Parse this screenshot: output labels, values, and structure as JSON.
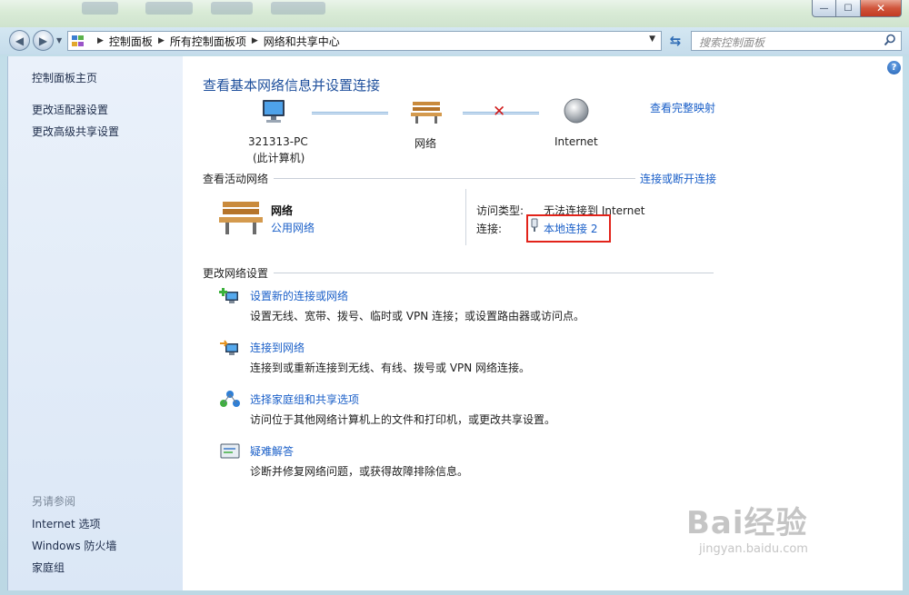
{
  "window": {
    "controls": {
      "minimize": "—",
      "maximize": "☐",
      "close": "✕"
    }
  },
  "address": {
    "breadcrumbs": [
      "控制面板",
      "所有控制面板项",
      "网络和共享中心"
    ],
    "search_placeholder": "搜索控制面板"
  },
  "sidebar": {
    "links": [
      "控制面板主页",
      "更改适配器设置",
      "更改高级共享设置"
    ],
    "see_also_heading": "另请参阅",
    "see_also": [
      "Internet 选项",
      "Windows 防火墙",
      "家庭组"
    ]
  },
  "main": {
    "help_icon": "?",
    "heading": "查看基本网络信息并设置连接",
    "view_full_map": "查看完整映射",
    "map": {
      "computer_line1": "321313-PC",
      "computer_line2": "(此计算机)",
      "network": "网络",
      "internet": "Internet",
      "status": "disconnected"
    },
    "active_networks": {
      "heading": "查看活动网络",
      "connect_disconnect": "连接或断开连接",
      "network_name": "网络",
      "network_type": "公用网络",
      "access_type_label": "访问类型:",
      "access_type_value": "无法连接到 Internet",
      "connections_label": "连接:",
      "connections_value": "本地连接 2"
    },
    "change_settings": {
      "heading": "更改网络设置",
      "tasks": [
        {
          "title": "设置新的连接或网络",
          "desc": "设置无线、宽带、拨号、临时或 VPN 连接；或设置路由器或访问点。",
          "icon": "new-connection-icon"
        },
        {
          "title": "连接到网络",
          "desc": "连接到或重新连接到无线、有线、拨号或 VPN 网络连接。",
          "icon": "connect-network-icon"
        },
        {
          "title": "选择家庭组和共享选项",
          "desc": "访问位于其他网络计算机上的文件和打印机，或更改共享设置。",
          "icon": "homegroup-icon"
        },
        {
          "title": "疑难解答",
          "desc": "诊断并修复网络问题，或获得故障排除信息。",
          "icon": "troubleshoot-icon"
        }
      ]
    }
  },
  "watermark": {
    "brand": "Bai经验",
    "url": "jingyan.baidu.com"
  },
  "colors": {
    "link": "#1a5fc8",
    "heading": "#1e4f9c",
    "highlight": "#e2231a",
    "error_x": "#d01b1b"
  }
}
